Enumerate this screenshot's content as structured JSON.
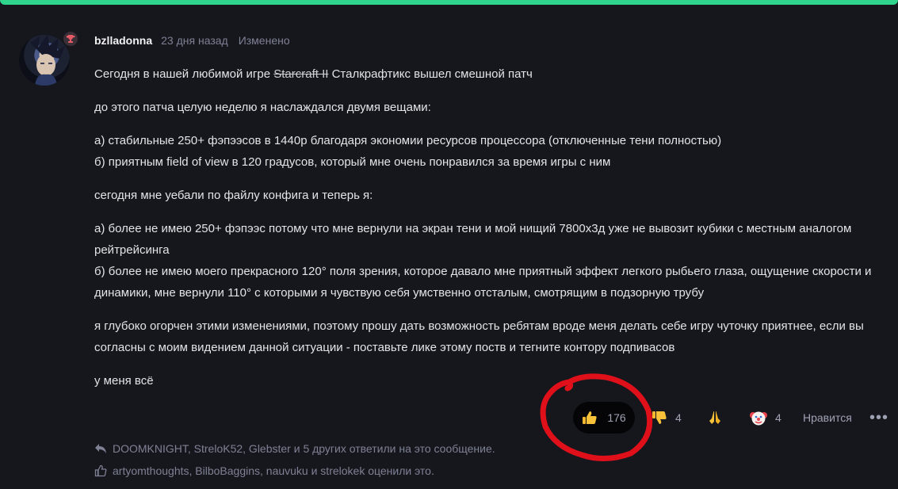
{
  "post": {
    "username": "bzlladonna",
    "time": "23 дня назад",
    "edited": "Изменено",
    "line1_before": "Сегодня в нашей любимой игре ",
    "line1_strike": "Starcraft II",
    "line1_after": " Сталкрафтикс вышел смешной патч",
    "p2": "до этого патча целую неделю я наслаждался двумя вещами:",
    "p3a": "а) стабильные 250+ фэпээсов в 1440р благодаря экономии ресурсов процессора (отключенные тени полностью)",
    "p3b": "б) приятным field of view в 120 градусов, который мне очень понравился за время игры с ним",
    "p4": "сегодня мне уебали по файлу конфига и теперь я:",
    "p5a": "а) более не имею 250+ фэпээс потому что мне вернули на экран тени и мой нищий 7800x3д уже не вывозит кубики с местным аналогом рейтрейсинга",
    "p5b": "б) более не имею моего прекрасного 120° поля зрения, которое давало мне приятный эффект легкого рыбьего глаза, ощущение скорости и динамики, мне вернули 110° с которыми я чувствую себя умственно отсталым, смотрящим в подзорную трубу",
    "p6": "я глубоко огорчен этими изменениями, поэтому прошу дать возможность ребятам вроде меня делать себе игру чуточку приятнее, если вы согласны с моим видением данной ситуации - поставьте лике этому поств и тегните контору подпивасов",
    "p7": "у меня всё"
  },
  "reactions": {
    "thumbs_up_count": "176",
    "thumbs_down_count": "4",
    "pray_count": "",
    "clown_count": "4",
    "like_label": "Нравится",
    "more_label": "•••"
  },
  "footer": {
    "replies": "DOOMKNIGHT, StreloK52, Glebster и 5 других ответили на это сообщение.",
    "likes": "artyomthoughts, BilboBaggins, nauvuku и strelokek оценили это."
  },
  "colors": {
    "accent": "#2fd48d",
    "background": "#16171d",
    "annotation": "#e0101a"
  }
}
